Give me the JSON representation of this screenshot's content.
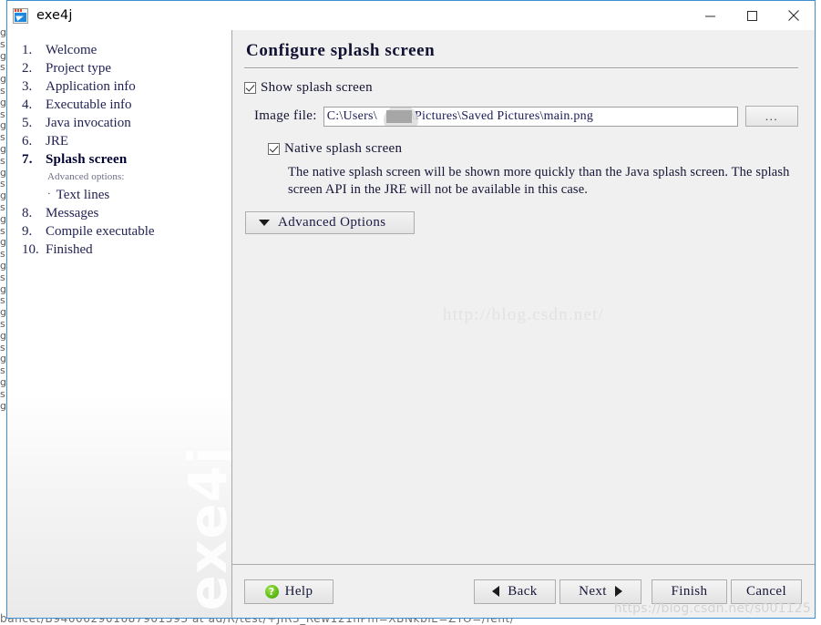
{
  "window": {
    "title": "exe4j",
    "app_icon": "exe4j-app-icon",
    "controls": {
      "minimize": "minimize-icon",
      "maximize": "maximize-icon",
      "close": "close-icon"
    }
  },
  "sidebar": {
    "steps": [
      {
        "num": "1.",
        "label": "Welcome",
        "current": false
      },
      {
        "num": "2.",
        "label": "Project type",
        "current": false
      },
      {
        "num": "3.",
        "label": "Application info",
        "current": false
      },
      {
        "num": "4.",
        "label": "Executable info",
        "current": false
      },
      {
        "num": "5.",
        "label": "Java invocation",
        "current": false
      },
      {
        "num": "6.",
        "label": "JRE",
        "current": false
      },
      {
        "num": "7.",
        "label": "Splash screen",
        "current": true
      }
    ],
    "sub_heading": "Advanced options:",
    "sub_items": [
      {
        "bullet": "·",
        "label": "Text lines"
      }
    ],
    "steps_after": [
      {
        "num": "8.",
        "label": "Messages",
        "current": false
      },
      {
        "num": "9.",
        "label": "Compile executable",
        "current": false
      },
      {
        "num": "10.",
        "label": "Finished",
        "current": false
      }
    ],
    "watermark": "exe4j"
  },
  "content": {
    "title": "Configure splash screen",
    "show_splash": {
      "label": "Show splash screen",
      "checked": true
    },
    "image_file": {
      "label": "Image file:",
      "value_before": "C:\\Users\\",
      "value_after": "\\Pictures\\Saved Pictures\\main.png",
      "redacted": true,
      "browse_label": "..."
    },
    "native_splash": {
      "label": "Native splash screen",
      "checked": true,
      "description": "The native splash screen will be shown more quickly than the Java splash screen. The splash screen API in the JRE will not be available in this case."
    },
    "advanced_options_label": "Advanced Options",
    "advanced_options_icon": "chevron-down-icon",
    "center_watermark": "http://blog.csdn.net/"
  },
  "footer": {
    "help_label": "Help",
    "help_icon": "question-mark-icon",
    "back_label": "Back",
    "back_icon": "arrow-left-icon",
    "next_label": "Next",
    "next_icon": "arrow-right-icon",
    "finish_label": "Finish",
    "cancel_label": "Cancel",
    "watermark": "https://blog.csdn.net/s001125"
  },
  "background": {
    "left_artifact": "g\ns\ng\ns\ng\ns\ng\ns\ng\ns\ng\ns\ng\ns\ng\ns\ng\ns\ng\ns\ng\ns\ng\ns\ng\ns\ng\ns\ng\ns\ng\ns\ng",
    "bottom_artifact": "bancet/B946062901687901593  at       ad/R/test/+JIR3_Rew121hPm=XBNkbiE=ZYO=/fent/"
  }
}
